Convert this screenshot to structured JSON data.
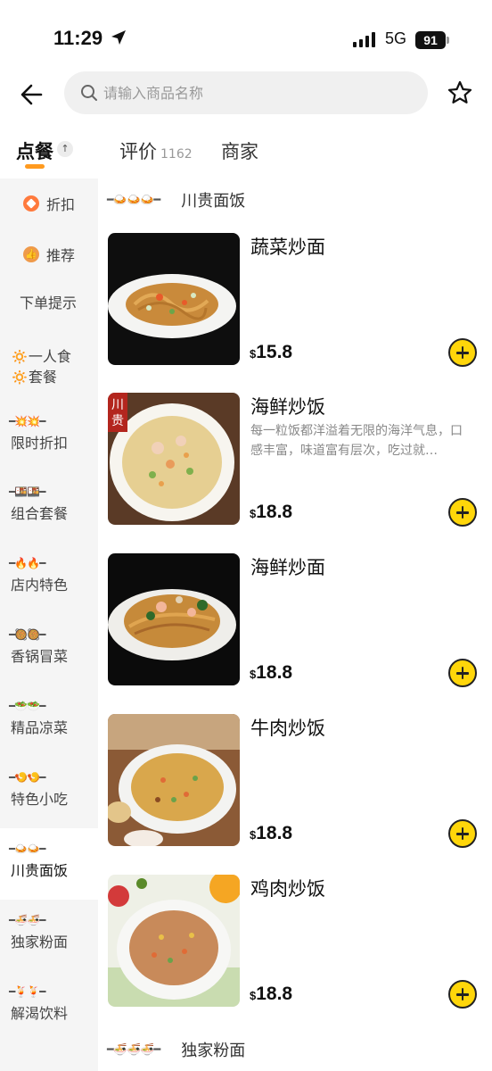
{
  "status": {
    "time": "11:29",
    "network": "5G",
    "battery": "91"
  },
  "search": {
    "placeholder": "请输入商品名称"
  },
  "tabs": {
    "order": "点餐",
    "reviews": "评价",
    "reviews_count": "1162",
    "merchant": "商家"
  },
  "sidebar": {
    "items": [
      {
        "label": "折扣"
      },
      {
        "label": "推荐"
      },
      {
        "label": "下单提示"
      },
      {
        "label_line1": "一人食",
        "label_line2": "套餐"
      },
      {
        "label": "限时折扣",
        "deco": "━💥💥━"
      },
      {
        "label": "组合套餐",
        "deco": "━🍱🍱━"
      },
      {
        "label": "店内特色",
        "deco": "━🔥🔥━"
      },
      {
        "label": "香锅冒菜",
        "deco": "━🥘🥘━"
      },
      {
        "label": "精品凉菜",
        "deco": "━🥗🥗━"
      },
      {
        "label": "特色小吃",
        "deco": "━🍤🍤━"
      },
      {
        "label": "川贵面饭",
        "deco": "━🍛🍛━"
      },
      {
        "label": "独家粉面",
        "deco": "━🍜🍜━"
      },
      {
        "label": "解渴饮料",
        "deco": "━🍹🍹━"
      }
    ]
  },
  "sections": {
    "first": {
      "title": "川贵面饭",
      "deco": "━🍛🍛🍛━"
    },
    "second": {
      "title": "独家粉面",
      "deco": "━🍜🍜🍜━"
    }
  },
  "items": [
    {
      "name": "蔬菜炒面",
      "desc": "",
      "price": "15.8",
      "currency": "$"
    },
    {
      "name": "海鲜炒饭",
      "desc": "每一粒饭都洋溢着无限的海洋气息，口感丰富，味道富有层次，吃过就…",
      "price": "18.8",
      "currency": "$"
    },
    {
      "name": "海鲜炒面",
      "desc": "",
      "price": "18.8",
      "currency": "$"
    },
    {
      "name": "牛肉炒饭",
      "desc": "",
      "price": "18.8",
      "currency": "$"
    },
    {
      "name": "鸡肉炒饭",
      "desc": "",
      "price": "18.8",
      "currency": "$"
    }
  ],
  "colors": {
    "accent": "#ffd60a",
    "tab_underline": "#ff9a1f",
    "sidebar_bg": "#f5f5f5"
  }
}
